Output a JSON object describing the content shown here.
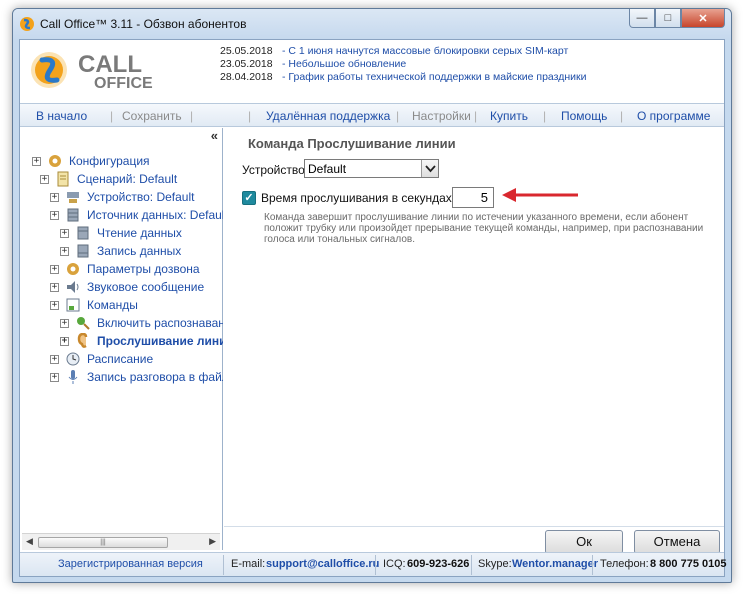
{
  "window": {
    "title": "Call Office™ 3.11 - Обзвон абонентов",
    "controls": {
      "minimize": "—",
      "maximize": "□",
      "close": "✕"
    }
  },
  "logo": {
    "line1": "CALL",
    "line2": "OFFICE"
  },
  "news": [
    {
      "date": "25.05.2018",
      "text": "С 1 июня начнутся массовые блокировки серых SIM-карт"
    },
    {
      "date": "23.05.2018",
      "text": "Небольшое обновление"
    },
    {
      "date": "28.04.2018",
      "text": "График работы технической поддержки в майские праздники"
    }
  ],
  "toolbar": {
    "home": "В начало",
    "save": "Сохранить",
    "remote": "Удалённая поддержка",
    "settings": "Настройки",
    "buy": "Купить",
    "help": "Помощь",
    "about": "О программе"
  },
  "tree": {
    "collapse_glyph": "«",
    "items": [
      {
        "label": "Конфигурация"
      },
      {
        "label": "Сценарий: Default"
      },
      {
        "label": "Устройство: Default"
      },
      {
        "label": "Источник данных: Default"
      },
      {
        "label": "Чтение данных"
      },
      {
        "label": "Запись данных"
      },
      {
        "label": "Параметры дозвона"
      },
      {
        "label": "Звуковое сообщение"
      },
      {
        "label": "Команды"
      },
      {
        "label": "Включить распознавани"
      },
      {
        "label": "Прослушивание линии"
      },
      {
        "label": "Расписание"
      },
      {
        "label": "Запись разговора в файл"
      }
    ]
  },
  "content": {
    "section_title": "Команда Прослушивание линии",
    "device_label": "Устройство:",
    "device_value": "Default",
    "checkbox_checked": true,
    "checkbox_label": "Время прослушивания в секундах:",
    "seconds_value": "5",
    "description": "Команда завершит прослушивание линии по истечении указанного времени, если абонент положит трубку или произойдет прерывание текущей команды, например, при распознавании голоса или тональных сигналов."
  },
  "buttons": {
    "ok": "Ок",
    "cancel": "Отмена"
  },
  "status": {
    "registered": "Зарегистрированная версия",
    "email_label": "E-mail:",
    "email": "support@calloffice.ru",
    "icq_label": "ICQ:",
    "icq": "609-923-626",
    "skype_label": "Skype:",
    "skype": "Wentor.manager",
    "phone_label": "Телефон:",
    "phone": "8 800 775 0105"
  },
  "colors": {
    "link": "#1f4ea8",
    "frame": "#c5d9ee",
    "checkbox": "#1f8a9e",
    "arrow": "#d9272e"
  }
}
